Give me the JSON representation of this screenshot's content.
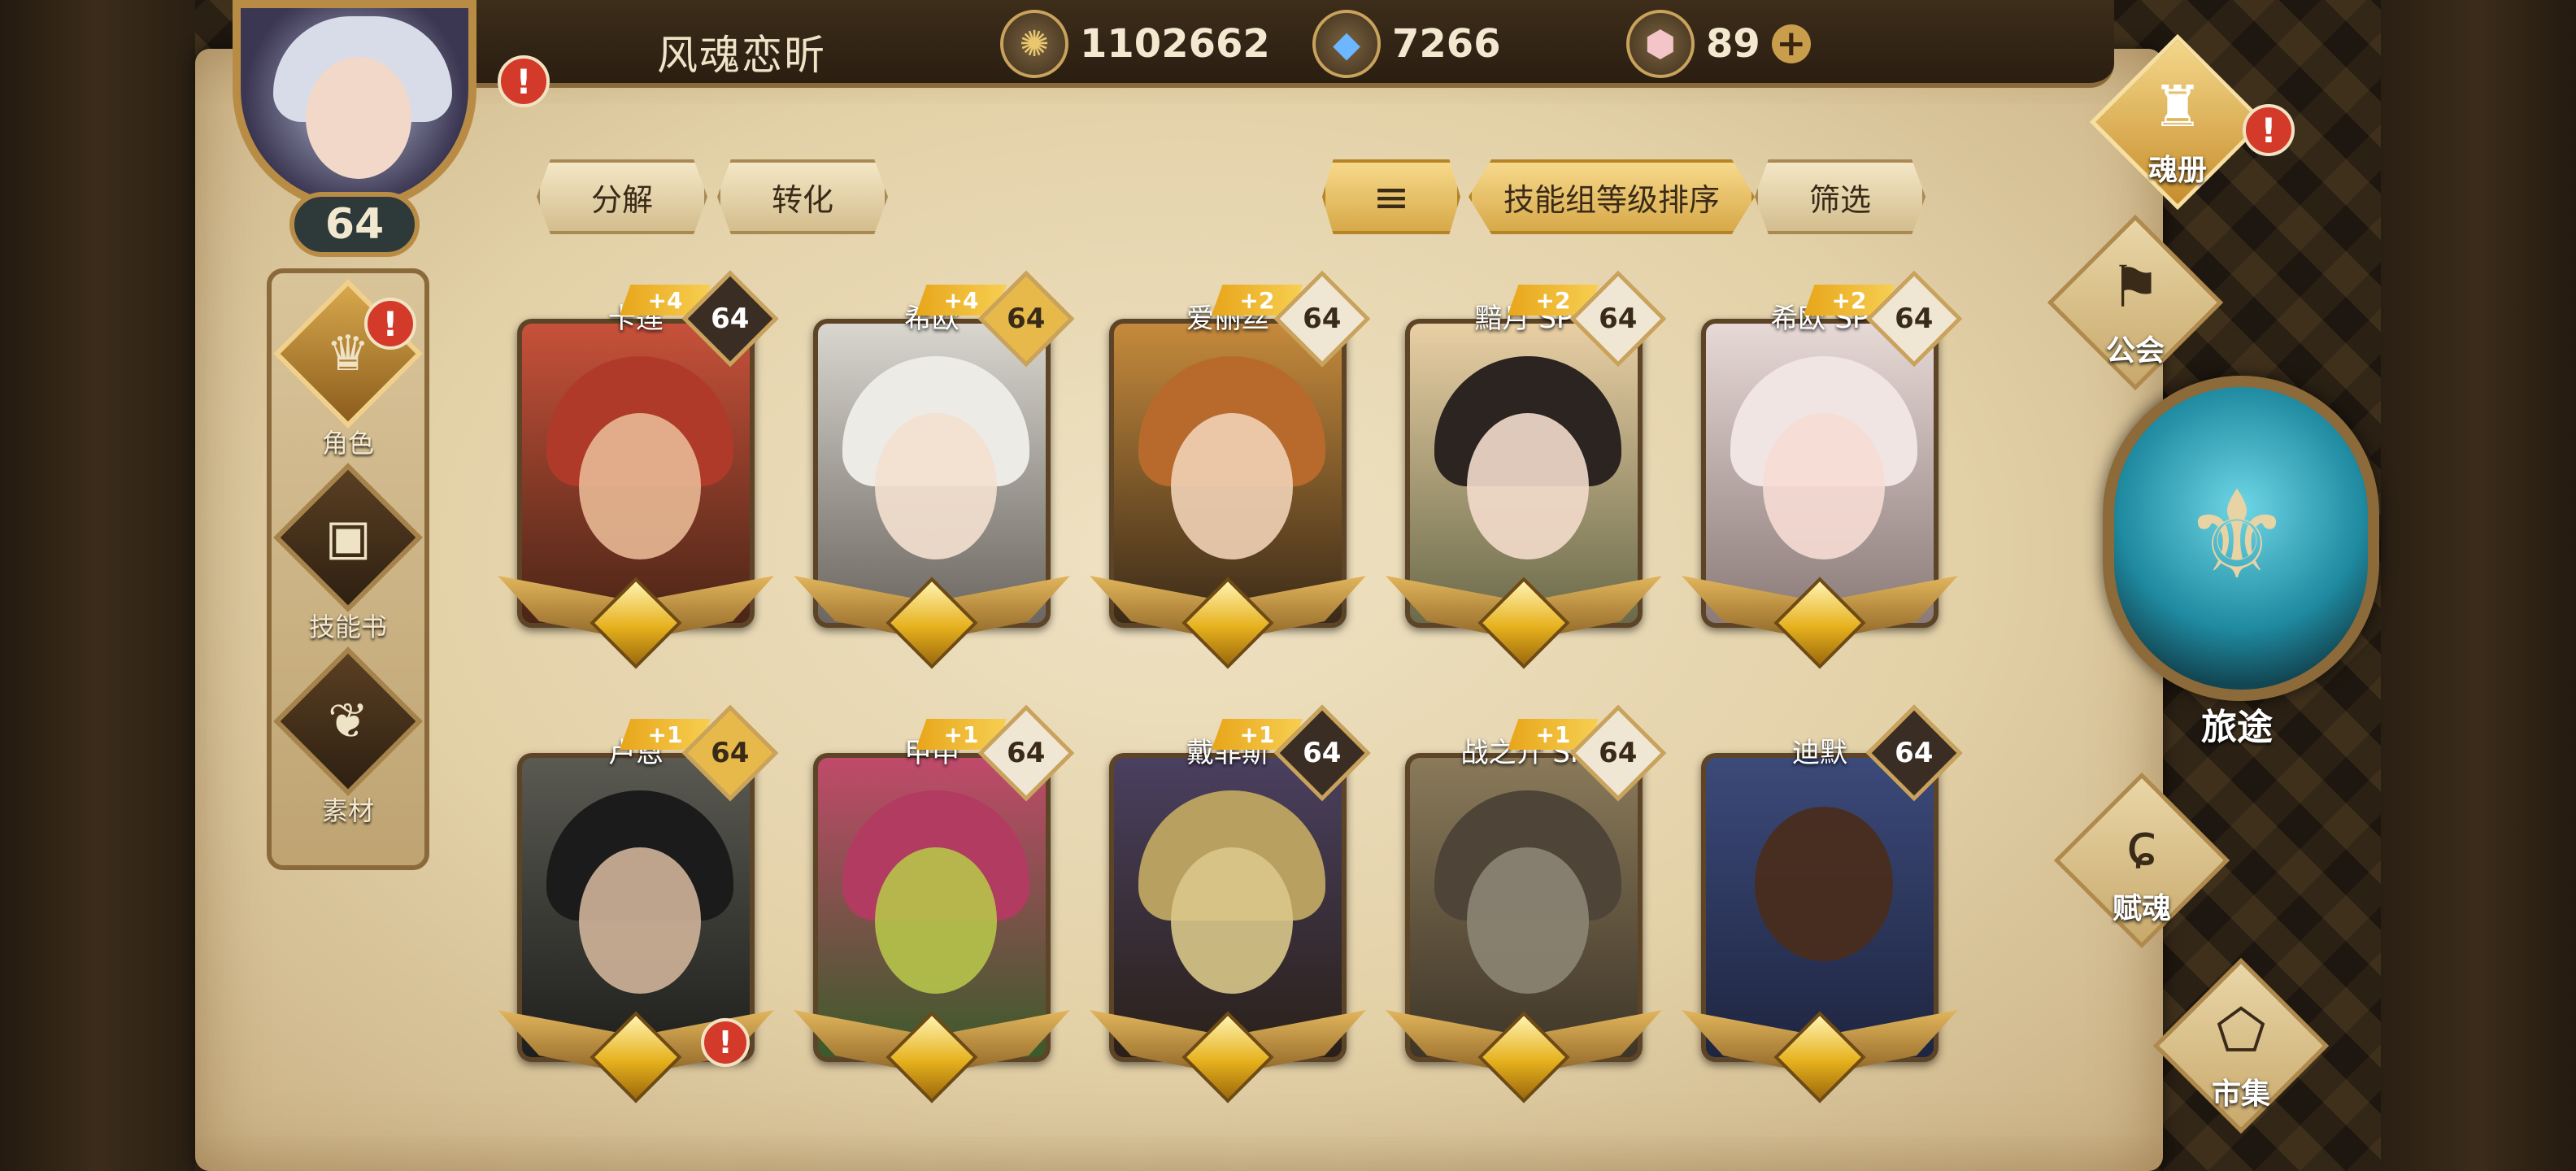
{
  "header": {
    "player_name": "风魂恋昕",
    "gold": "1102662",
    "crystals": "7266",
    "gems": "89",
    "plus": "+"
  },
  "player": {
    "level": "64",
    "alert": "!"
  },
  "left_nav": [
    {
      "label": "角色",
      "icon": "character-icon",
      "glyph": "♛",
      "active": true,
      "alert": "!"
    },
    {
      "label": "技能书",
      "icon": "skill-book-icon",
      "glyph": "▣"
    },
    {
      "label": "素材",
      "icon": "material-icon",
      "glyph": "❦"
    }
  ],
  "toolbar": {
    "decompose": "分解",
    "convert": "转化",
    "sort_icon": "≡",
    "sort_mode": "技能组等级排序",
    "filter": "筛选"
  },
  "cards": [
    {
      "name": "卡莲",
      "plus": "+4",
      "level": "64",
      "level_style": "dark"
    },
    {
      "name": "希欧",
      "plus": "+4",
      "level": "64",
      "level_style": "gold"
    },
    {
      "name": "爱丽丝",
      "plus": "+2",
      "level": "64",
      "level_style": "light"
    },
    {
      "name": "黯月 SP",
      "plus": "+2",
      "level": "64",
      "level_style": "light"
    },
    {
      "name": "希欧 SP",
      "plus": "+2",
      "level": "64",
      "level_style": "light"
    },
    {
      "name": "卢恩",
      "plus": "+1",
      "level": "64",
      "level_style": "gold",
      "alert": "!"
    },
    {
      "name": "甲申",
      "plus": "+1",
      "level": "64",
      "level_style": "light"
    },
    {
      "name": "戴菲斯",
      "plus": "+1",
      "level": "64",
      "level_style": "dark"
    },
    {
      "name": "战之介 SP",
      "plus": "+1",
      "level": "64",
      "level_style": "light"
    },
    {
      "name": "迪默",
      "plus": "",
      "level": "64",
      "level_style": "dark"
    }
  ],
  "right_nav": {
    "soul_book": "魂册",
    "guild": "公会",
    "journey": "旅途",
    "endow_soul": "赋魂",
    "market": "市集",
    "soul_book_alert": "!"
  },
  "colors": {
    "parchment": "#e3d1a8",
    "gold_accent": "#d7a949",
    "alert_red": "#d33a2a",
    "journey_orb": "#1f8aa0"
  }
}
